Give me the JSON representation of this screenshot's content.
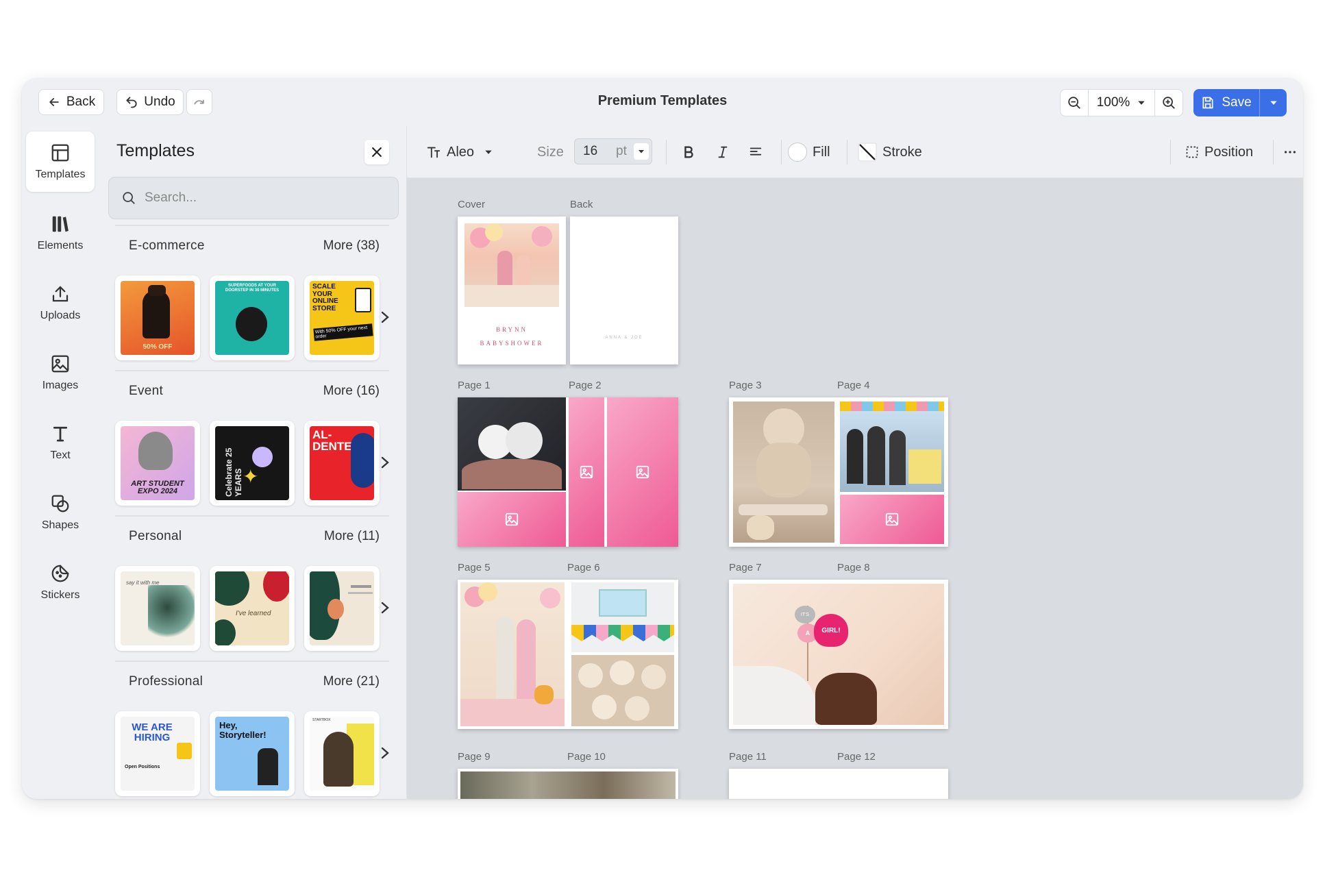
{
  "header": {
    "back_label": "Back",
    "undo_label": "Undo",
    "title": "Premium Templates",
    "zoom": "100%",
    "save_label": "Save"
  },
  "rail": [
    {
      "label": "Templates",
      "icon": "templates-icon",
      "active": true
    },
    {
      "label": "Elements",
      "icon": "elements-icon"
    },
    {
      "label": "Uploads",
      "icon": "upload-icon"
    },
    {
      "label": "Images",
      "icon": "image-icon"
    },
    {
      "label": "Text",
      "icon": "text-icon"
    },
    {
      "label": "Shapes",
      "icon": "shapes-icon"
    },
    {
      "label": "Stickers",
      "icon": "sticker-icon"
    }
  ],
  "panel": {
    "title": "Templates",
    "search_placeholder": "Search...",
    "categories": [
      {
        "name": "E-commerce",
        "more": "More (38)",
        "thumbs": [
          {
            "text": "50% OFF"
          },
          {
            "text": "SUPERFOODS AT YOUR DOORSTEP IN 30 MINUTES"
          },
          {
            "text": "SCALE YOUR ONLINE STORE",
            "sub": "With 50% OFF your next order"
          }
        ]
      },
      {
        "name": "Event",
        "more": "More (16)",
        "thumbs": [
          {
            "text": "ART STUDENT EXPO 2024"
          },
          {
            "text": "Celebrate 25 YEARS"
          },
          {
            "text": "AL-DENTE"
          }
        ]
      },
      {
        "name": "Personal",
        "more": "More (11)",
        "thumbs": [
          {
            "text": "say it with me"
          },
          {
            "text": "I've learned"
          },
          {
            "text": ""
          }
        ]
      },
      {
        "name": "Professional",
        "more": "More (21)",
        "thumbs": [
          {
            "text": "WE ARE HIRING",
            "sub": "Open Positions"
          },
          {
            "text": "Hey, Storyteller!"
          },
          {
            "text": "STARTBOX"
          }
        ]
      }
    ]
  },
  "toolbar": {
    "font": "Aleo",
    "size_label": "Size",
    "size_value": "16",
    "size_unit": "pt",
    "fill_label": "Fill",
    "stroke_label": "Stroke",
    "position_label": "Position"
  },
  "canvas": {
    "cover_label": "Cover",
    "back_label": "Back",
    "cover_text_1": "BRYNN",
    "cover_text_2": "BABYSHOWER",
    "back_text": "ANNA & JOE",
    "pages": [
      "Page 1",
      "Page 2",
      "Page 3",
      "Page 4",
      "Page 5",
      "Page 6",
      "Page 7",
      "Page 8",
      "Page 9",
      "Page 10",
      "Page 11",
      "Page 12"
    ],
    "sticker_its": "IT'S",
    "sticker_a": "A",
    "sticker_girl": "GIRL!"
  },
  "colors": {
    "accent": "#3b6fe8",
    "pink": "#ee5a94"
  }
}
